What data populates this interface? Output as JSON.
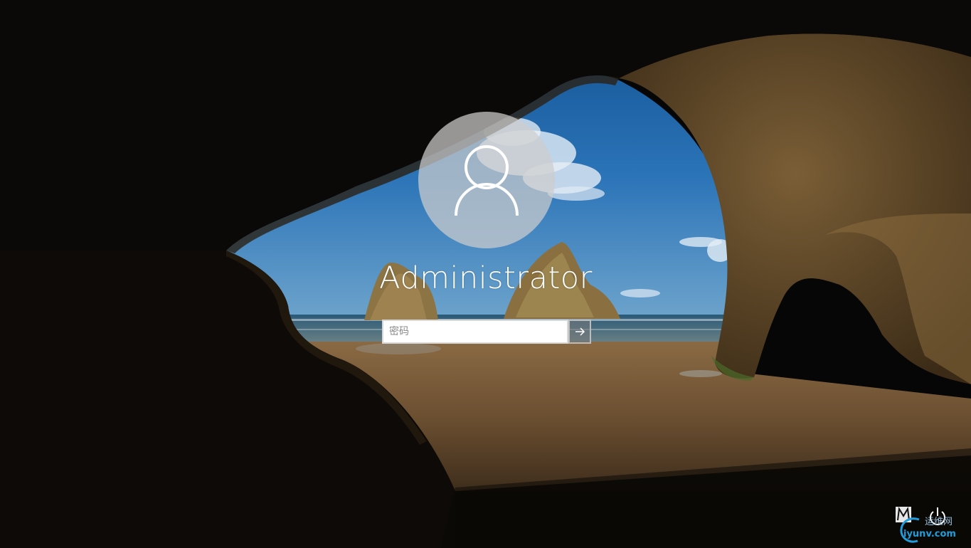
{
  "login": {
    "username": "Administrator",
    "password_placeholder": "密码",
    "password_value": ""
  },
  "icons": {
    "avatar": "user-silhouette-icon",
    "submit": "arrow-right-icon",
    "ease_of_access": "ease-of-access-icon",
    "power": "power-icon"
  },
  "watermark": {
    "text_cn": "运维网",
    "text_url": "iyunv.com"
  },
  "colors": {
    "avatar_bg": "#cdcdcd",
    "input_bg": "#ffffff",
    "watermark_blue": "#1f9ddc"
  }
}
